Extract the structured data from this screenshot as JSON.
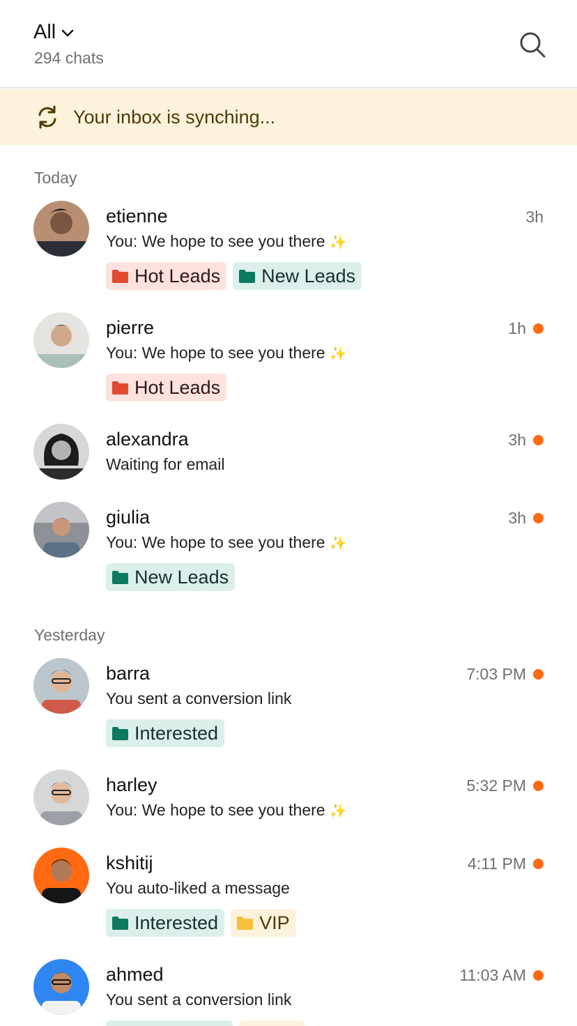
{
  "header": {
    "filter_label": "All",
    "chat_count": "294 chats"
  },
  "sync_banner": {
    "text": "Your inbox is synching..."
  },
  "sections": {
    "today": "Today",
    "yesterday": "Yesterday"
  },
  "colors": {
    "unread_dot": "#ff6a13",
    "hot_leads_bg": "#fde2df",
    "hot_leads_fg": "#2c1a18",
    "hot_leads_icon": "#e04a2f",
    "new_leads_bg": "#dcefeb",
    "new_leads_fg": "#13322c",
    "new_leads_icon": "#0b7a5e",
    "interested_bg": "#dcefeb",
    "interested_fg": "#13322c",
    "interested_icon": "#0b7a5e",
    "vip_bg": "#fdf3dd",
    "vip_fg": "#4f3a05",
    "vip_icon": "#f6c13a",
    "sync_banner_bg": "#fdf3dd"
  },
  "icons": {
    "filter": "chevron-down-icon",
    "search": "search-icon",
    "sync": "refresh-icon",
    "tag": "folder-icon",
    "sparkle": "sparkles-icon"
  },
  "chats": [
    {
      "name": "etienne",
      "time": "3h",
      "unread": false,
      "preview": "You: We hope to see you there",
      "sparkle": "✨",
      "tags": [
        "Hot Leads",
        "New Leads"
      ]
    },
    {
      "name": "pierre",
      "time": "1h",
      "unread": true,
      "preview": "You: We hope to see you there",
      "sparkle": "✨",
      "tags": [
        "Hot Leads"
      ]
    },
    {
      "name": "alexandra",
      "time": "3h",
      "unread": true,
      "preview": "Waiting for email",
      "sparkle": "",
      "tags": []
    },
    {
      "name": "giulia",
      "time": "3h",
      "unread": true,
      "preview": "You: We hope to see you there",
      "sparkle": "✨",
      "tags": [
        "New Leads"
      ]
    },
    {
      "name": "barra",
      "time": "7:03 PM",
      "unread": true,
      "preview": "You sent a conversion link",
      "sparkle": "",
      "tags": [
        "Interested"
      ]
    },
    {
      "name": "harley",
      "time": "5:32 PM",
      "unread": true,
      "preview": "You: We hope to see you there",
      "sparkle": "✨",
      "tags": []
    },
    {
      "name": "kshitij",
      "time": "4:11 PM",
      "unread": true,
      "preview": "You auto-liked a message",
      "sparkle": "",
      "tags": [
        "Interested",
        "VIP"
      ]
    },
    {
      "name": "ahmed",
      "time": "11:03 AM",
      "unread": true,
      "preview": "You sent a conversion link",
      "sparkle": "",
      "tags": []
    }
  ]
}
